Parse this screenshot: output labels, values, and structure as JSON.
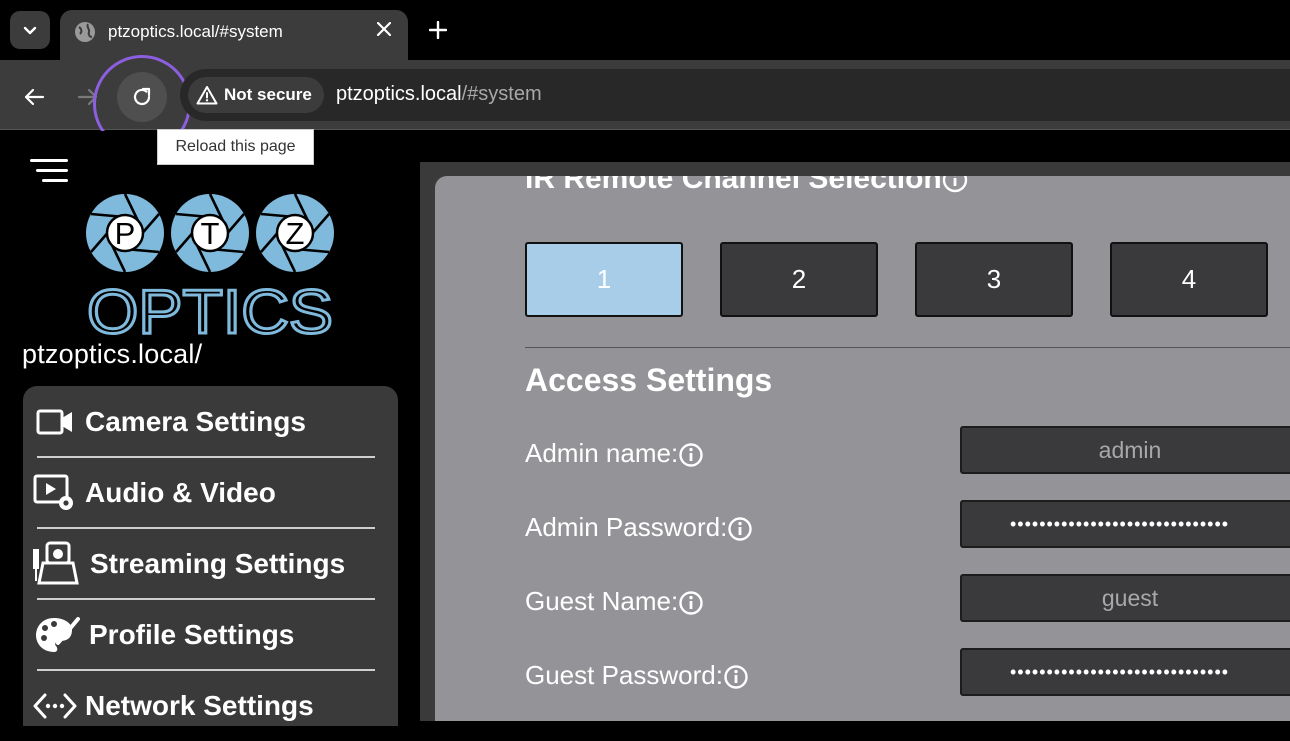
{
  "browser": {
    "tab_title": "ptzoptics.local/#system",
    "security_label": "Not secure",
    "url_host": "ptzoptics.local",
    "url_path": "/#system",
    "tooltip": "Reload this page",
    "highlight_color": "#8c5fe0"
  },
  "logo": {
    "letters": [
      "P",
      "T",
      "Z"
    ],
    "wordmark": "OPTICS",
    "brand_color": "#7fb9dc"
  },
  "sidebar": {
    "host_label": "ptzoptics.local/",
    "items": [
      {
        "label": "Camera Settings",
        "icon": "video-camera-icon"
      },
      {
        "label": "Audio & Video",
        "icon": "video-settings-icon"
      },
      {
        "label": "Streaming Settings",
        "icon": "ptz-camera-icon"
      },
      {
        "label": "Profile Settings",
        "icon": "palette-icon"
      },
      {
        "label": "Network Settings",
        "icon": "network-icon"
      }
    ]
  },
  "main": {
    "ir_heading": "IR Remote Channel Selection",
    "channels": [
      "1",
      "2",
      "3",
      "4"
    ],
    "active_channel": "1",
    "access_heading": "Access Settings",
    "fields": [
      {
        "label": "Admin name:",
        "value": "admin"
      },
      {
        "label": "Admin Password:",
        "value": "••••••••••••••••••••••••••••••"
      },
      {
        "label": "Guest Name:",
        "value": "guest"
      },
      {
        "label": "Guest Password:",
        "value": "••••••••••••••••••••••••••••••"
      }
    ]
  }
}
